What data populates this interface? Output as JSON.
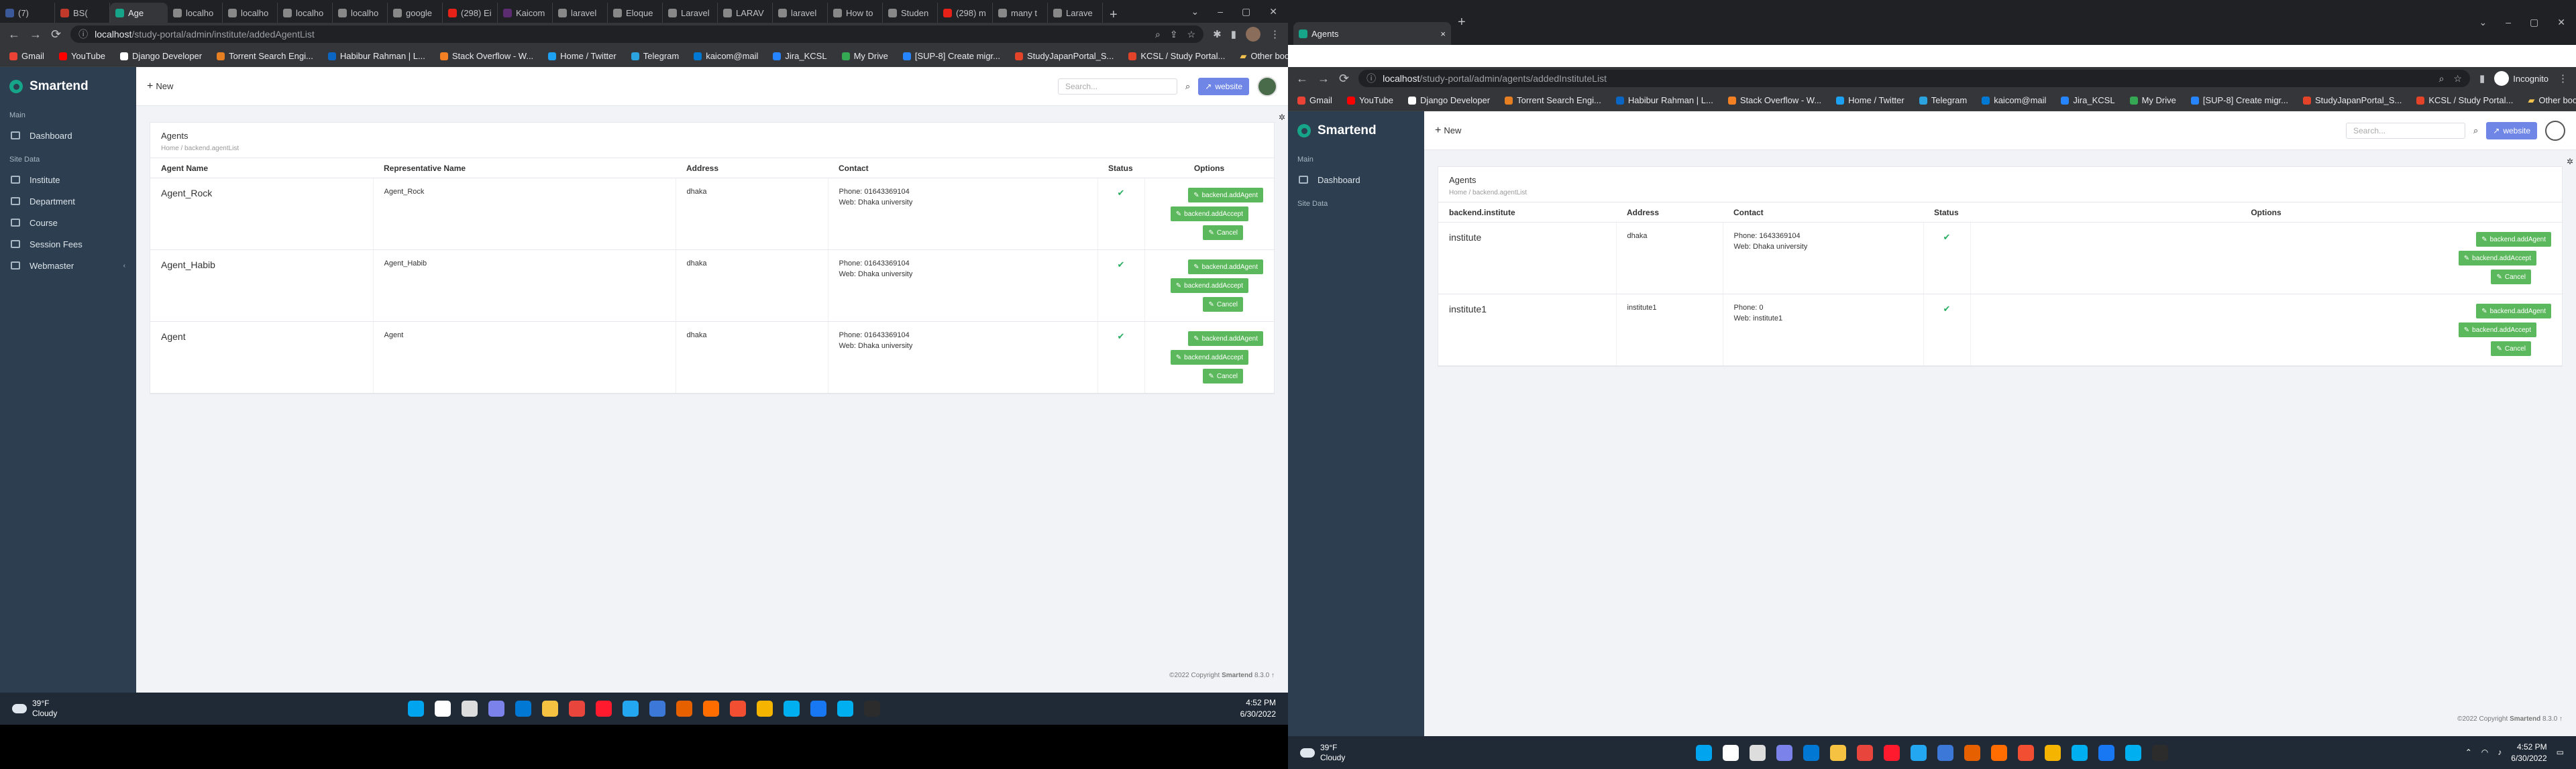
{
  "left": {
    "tabs": [
      {
        "label": "(7)",
        "color": "#3b5998"
      },
      {
        "label": "BS(",
        "color": "#c0392b"
      },
      {
        "label": "Age",
        "color": "#17a589",
        "active": true
      },
      {
        "label": "localho",
        "color": "#888"
      },
      {
        "label": "localho",
        "color": "#888"
      },
      {
        "label": "localho",
        "color": "#888"
      },
      {
        "label": "localho",
        "color": "#888"
      },
      {
        "label": "google",
        "color": "#888"
      },
      {
        "label": "(298) Ei",
        "color": "#e62117"
      },
      {
        "label": "Kaicom",
        "color": "#5b2c6f"
      },
      {
        "label": "laravel",
        "color": "#888"
      },
      {
        "label": "Eloque",
        "color": "#888"
      },
      {
        "label": "Laravel",
        "color": "#888"
      },
      {
        "label": "LARAV",
        "color": "#888"
      },
      {
        "label": "laravel",
        "color": "#888"
      },
      {
        "label": "How to",
        "color": "#888"
      },
      {
        "label": "Studen",
        "color": "#888"
      },
      {
        "label": "(298) m",
        "color": "#e62117"
      },
      {
        "label": "many t",
        "color": "#888"
      },
      {
        "label": "Larave",
        "color": "#888"
      }
    ],
    "url_host": "localhost",
    "url_path": "/study-portal/admin/institute/addedAgentList",
    "page_title": "Agents",
    "breadcrumb": "Home / backend.agentList",
    "columns": [
      "Agent Name",
      "Representative Name",
      "Address",
      "Contact",
      "Status",
      "Options"
    ],
    "rows": [
      {
        "name": "Agent_Rock",
        "rep": "Agent_Rock",
        "address": "dhaka",
        "phone": "Phone: 01643369104",
        "web": "Web: Dhaka university"
      },
      {
        "name": "Agent_Habib",
        "rep": "Agent_Habib",
        "address": "dhaka",
        "phone": "Phone: 01643369104",
        "web": "Web: Dhaka university"
      },
      {
        "name": "Agent",
        "rep": "Agent",
        "address": "dhaka",
        "phone": "Phone: 01643369104",
        "web": "Web: Dhaka university"
      }
    ],
    "sidebar": [
      {
        "label": "Dashboard",
        "icon": "dashboard-icon"
      },
      {
        "label": "Institute",
        "icon": "institute-icon"
      },
      {
        "label": "Department",
        "icon": "department-icon"
      },
      {
        "label": "Course",
        "icon": "course-icon"
      },
      {
        "label": "Session Fees",
        "icon": "fees-icon"
      },
      {
        "label": "Webmaster",
        "icon": "webmaster-icon"
      }
    ],
    "weather_temp": "39°F",
    "weather_desc": "Cloudy",
    "time": "4:52 PM",
    "date": "6/30/2022"
  },
  "right": {
    "tab_label": "Agents",
    "url_host": "localhost",
    "url_path": "/study-portal/admin/agents/addedInstituteList",
    "incognito": "Incognito",
    "page_title": "Agents",
    "breadcrumb": "Home / backend.agentList",
    "columns": [
      "backend.institute",
      "Address",
      "Contact",
      "Status",
      "Options"
    ],
    "rows": [
      {
        "name": "institute",
        "address": "dhaka",
        "phone": "Phone: 1643369104",
        "web": "Web: Dhaka university"
      },
      {
        "name": "institute1",
        "address": "institute1",
        "phone": "Phone: 0",
        "web": "Web: institute1"
      }
    ],
    "sidebar": [
      {
        "label": "Dashboard",
        "icon": "dashboard-icon"
      }
    ],
    "weather_temp": "39°F",
    "weather_desc": "Cloudy",
    "time": "4:52 PM",
    "date": "6/30/2022"
  },
  "common": {
    "brand": "Smartend",
    "new_label": "New",
    "search_placeholder": "Search...",
    "website_label": "website",
    "side_main": "Main",
    "side_site_data": "Site Data",
    "btn_agent": "backend.addAgent",
    "btn_accept": "backend.addAccept",
    "btn_cancel": "Cancel",
    "copyright_left": "©2022 Copyright",
    "copyright_right": "©2022 Copyright",
    "copyright_brand": "Smartend",
    "version": "8.3.0",
    "bookmarks": [
      {
        "label": "Gmail",
        "color": "#ea4335"
      },
      {
        "label": "YouTube",
        "color": "#ff0000"
      },
      {
        "label": "Django Developer",
        "color": "#fff"
      },
      {
        "label": "Torrent Search Engi...",
        "color": "#e67e22"
      },
      {
        "label": "Habibur Rahman | L...",
        "color": "#0a66c2"
      },
      {
        "label": "Stack Overflow - W...",
        "color": "#f48024"
      },
      {
        "label": "Home / Twitter",
        "color": "#1da1f2"
      },
      {
        "label": "Telegram",
        "color": "#2aa3de"
      },
      {
        "label": "kaicom@mail",
        "color": "#0078d4"
      },
      {
        "label": "Jira_KCSL",
        "color": "#2684ff"
      },
      {
        "label": "My Drive",
        "color": "#34a853"
      },
      {
        "label": "[SUP-8] Create migr...",
        "color": "#2684ff"
      },
      {
        "label": "StudyJapanPortal_S...",
        "color": "#e24329"
      },
      {
        "label": "KCSL / Study Portal...",
        "color": "#e24329"
      }
    ],
    "other_bookmarks": "Other bookmarks",
    "taskbar_apps": [
      "#00a4ef",
      "#fff",
      "#ddd",
      "#7b83eb",
      "#0078d4",
      "#f5c242",
      "#e8453c",
      "#ff1b2d",
      "#22a7f0",
      "#3c78d8",
      "#e66000",
      "#ff6d00",
      "#f14e32",
      "#f4b400",
      "#00aff0",
      "#1877f2",
      "#00aff0",
      "#2c2c2c"
    ]
  }
}
